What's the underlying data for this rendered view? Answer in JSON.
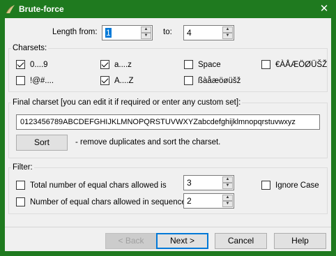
{
  "window": {
    "title": "Brute-force",
    "close_glyph": "✕",
    "accent": "#1f7a1f"
  },
  "length": {
    "from_label": "Length from:",
    "from_value": "1",
    "to_label": "to:",
    "to_value": "4"
  },
  "charsets": {
    "title": "Charsets:",
    "items": [
      {
        "label": "0....9",
        "checked": true
      },
      {
        "label": "a....z",
        "checked": true
      },
      {
        "label": "Space",
        "checked": false
      },
      {
        "label": "€ÀÅÆÖØÜŠŽ",
        "checked": false
      },
      {
        "label": "!@#....",
        "checked": false
      },
      {
        "label": "A....Z",
        "checked": true
      },
      {
        "label": "ßàåæöøüšž",
        "checked": false
      }
    ]
  },
  "final_charset": {
    "title": "Final charset [you can edit it if required or enter any custom set]:",
    "value": "0123456789ABCDEFGHIJKLMNOPQRSTUVWXYZabcdefghijklmnopqrstuvwxyz",
    "sort_label": "Sort",
    "sort_hint": "- remove duplicates and sort the charset."
  },
  "filter": {
    "title": "Filter:",
    "total_label": "Total number of equal chars allowed is",
    "total_value": "3",
    "total_checked": false,
    "seq_label": "Number of equal chars allowed in sequence is",
    "seq_value": "2",
    "seq_checked": false,
    "ignore_case_label": "Ignore Case",
    "ignore_case_checked": false
  },
  "buttons": {
    "back": "< Back",
    "next": "Next >",
    "cancel": "Cancel",
    "help": "Help"
  }
}
